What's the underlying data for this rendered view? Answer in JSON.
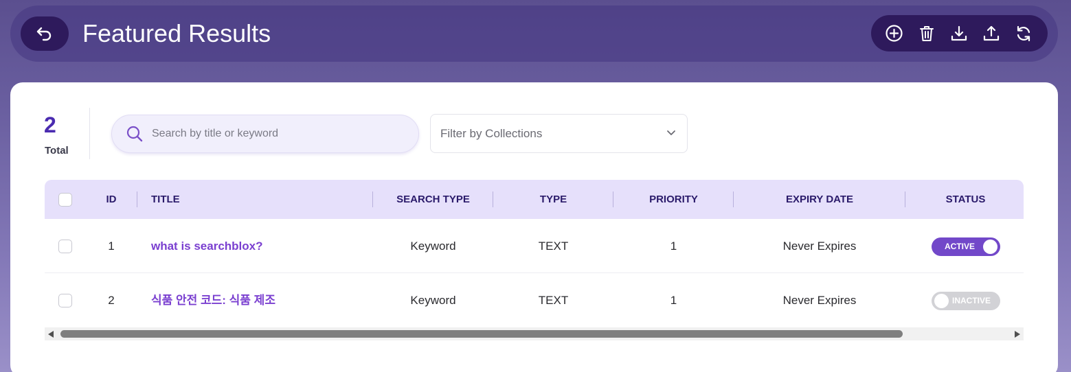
{
  "header": {
    "title": "Featured Results",
    "toolbar_icons": [
      "add-circle-icon",
      "trash-icon",
      "download-icon",
      "upload-icon",
      "refresh-icon"
    ]
  },
  "summary": {
    "total_count": "2",
    "total_label": "Total"
  },
  "search": {
    "placeholder": "Search by title or keyword",
    "value": ""
  },
  "filter": {
    "placeholder": "Filter by Collections"
  },
  "table": {
    "columns": [
      "ID",
      "TITLE",
      "SEARCH TYPE",
      "TYPE",
      "PRIORITY",
      "EXPIRY DATE",
      "STATUS"
    ],
    "rows": [
      {
        "id": "1",
        "title": "what is searchblox?",
        "search_type": "Keyword",
        "type": "TEXT",
        "priority": "1",
        "expiry": "Never Expires",
        "status": "ACTIVE",
        "active": true
      },
      {
        "id": "2",
        "title": "식품 안전 코드: 식품 제조",
        "search_type": "Keyword",
        "type": "TEXT",
        "priority": "1",
        "expiry": "Never Expires",
        "status": "INACTIVE",
        "active": false
      }
    ]
  },
  "colors": {
    "accent": "#7248c9",
    "header_dark": "#2e1a5c",
    "title_link": "#7a3fd0",
    "table_header_bg": "#e6e0fb"
  }
}
